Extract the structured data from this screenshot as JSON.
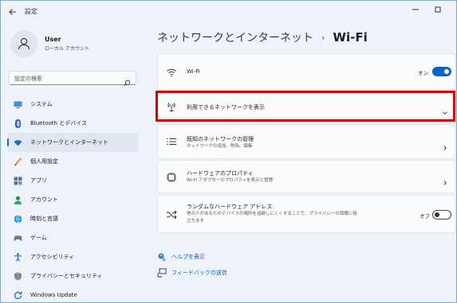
{
  "window": {
    "app_title": "設定",
    "back_icon": "back-arrow-icon",
    "controls": [
      "minimize-icon",
      "maximize-icon",
      "close-icon"
    ]
  },
  "user": {
    "name": "User",
    "subtitle": "ローカル アカウント"
  },
  "search": {
    "placeholder": "設定の検索"
  },
  "sidebar": {
    "items": [
      {
        "label": "システム",
        "icon": "monitor-icon"
      },
      {
        "label": "Bluetooth とデバイス",
        "icon": "bluetooth-icon"
      },
      {
        "label": "ネットワークとインターネット",
        "icon": "wifi-icon",
        "active": true
      },
      {
        "label": "個人用設定",
        "icon": "brush-icon"
      },
      {
        "label": "アプリ",
        "icon": "apps-icon"
      },
      {
        "label": "アカウント",
        "icon": "account-icon"
      },
      {
        "label": "時刻と言語",
        "icon": "globe-clock-icon"
      },
      {
        "label": "ゲーム",
        "icon": "gamepad-icon"
      },
      {
        "label": "アクセシビリティ",
        "icon": "accessibility-icon"
      },
      {
        "label": "プライバシーとセキュリティ",
        "icon": "shield-icon"
      },
      {
        "label": "Windows Update",
        "icon": "update-icon"
      }
    ]
  },
  "breadcrumb": {
    "parent": "ネットワークとインターネット",
    "separator": "›",
    "current": "Wi-Fi"
  },
  "cards": {
    "wifi": {
      "title": "Wi-Fi",
      "state_label": "オン",
      "state": "on",
      "icon": "wifi-icon"
    },
    "available": {
      "title": "利用できるネットワークを表示",
      "icon": "antenna-icon"
    },
    "known": {
      "title": "既知のネットワークの管理",
      "subtitle": "ネットワークの追加、削除、編集",
      "icon": "list-icon"
    },
    "hardware": {
      "title": "ハードウェアのプロパティ",
      "subtitle": "Wi-Fi アダプターのプロパティを表示と管理",
      "icon": "chip-icon"
    },
    "random": {
      "title": "ランダムなハードウェア アドレス",
      "subtitle_line1": "他の人があなたのデバイスの場所を追跡しにくくすることで、プライバシーの保護に役",
      "subtitle_line2": "立ちます",
      "state_label": "オフ",
      "state": "off",
      "icon": "shuffle-icon"
    }
  },
  "links": {
    "help": "ヘルプを表示",
    "feedback": "フィードバックの送信"
  },
  "colors": {
    "accent": "#0a64c8",
    "highlight": "#d40000"
  }
}
